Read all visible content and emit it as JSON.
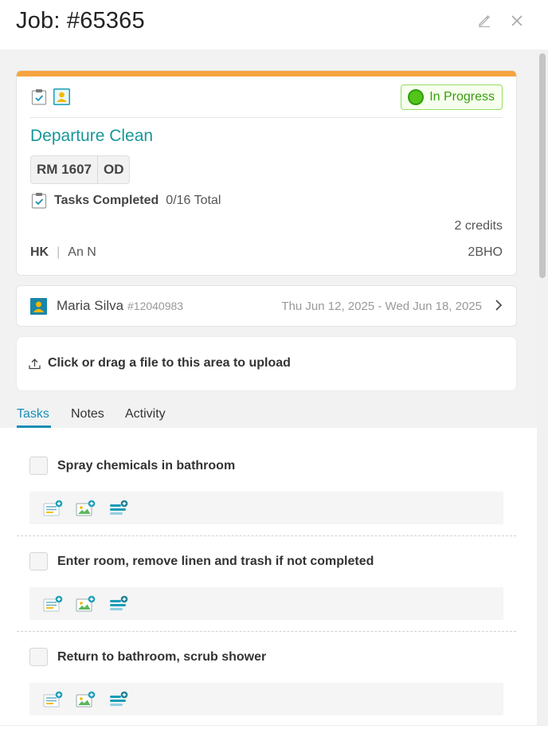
{
  "header": {
    "title": "Job: #65365",
    "edit_icon": "pencil-icon",
    "close_icon": "close-icon"
  },
  "job": {
    "type_icons": [
      "clipboard-check-icon",
      "guest-profile-icon"
    ],
    "status": "In Progress",
    "status_color": "#52c41a",
    "accent_color": "#f7a440",
    "service": "Departure Clean",
    "service_color": "#18979a",
    "room": "RM 1607",
    "room_status": "OD",
    "tasks_label": "Tasks Completed",
    "tasks_value": "0/16 Total",
    "credits": "2 credits",
    "department": "HK",
    "assignee": "An N",
    "room_type": "2BHO"
  },
  "guest": {
    "name": "Maria Silva",
    "id": "#12040983",
    "dates": "Thu Jun 12, 2025 - Wed Jun 18, 2025"
  },
  "upload": {
    "label": "Click or drag a file to this area to upload"
  },
  "tabs": [
    {
      "label": "Tasks",
      "active": true
    },
    {
      "label": "Notes",
      "active": false
    },
    {
      "label": "Activity",
      "active": false
    }
  ],
  "tab_accent_color": "#1a8fb8",
  "tasks": [
    {
      "name": "Spray chemicals in bathroom",
      "checked": false
    },
    {
      "name": "Enter room, remove linen and trash if not completed",
      "checked": false
    },
    {
      "name": "Return to bathroom, scrub shower",
      "checked": false
    }
  ],
  "task_actions": [
    "add-note-icon",
    "add-photo-icon",
    "add-subtask-icon"
  ]
}
